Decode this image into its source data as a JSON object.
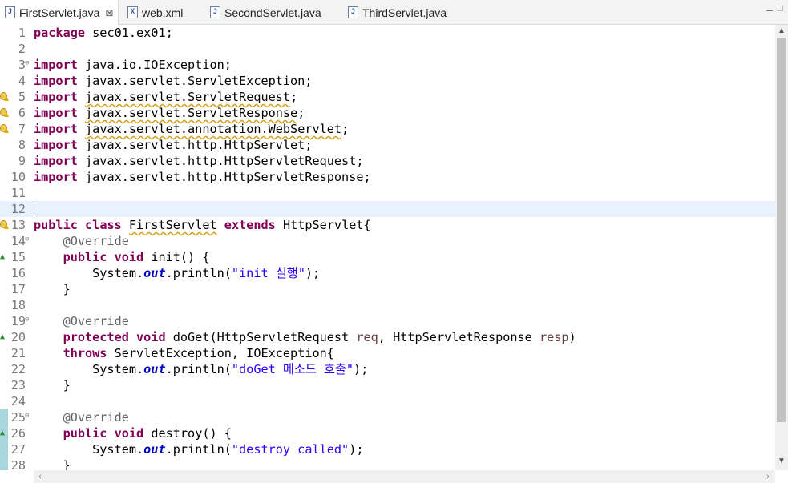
{
  "tabs": [
    {
      "label": "FirstServlet.java",
      "icon": "java-file-icon",
      "glyph": "J",
      "active": true,
      "close": "⊠"
    },
    {
      "label": "web.xml",
      "icon": "xml-file-icon",
      "glyph": "X"
    },
    {
      "label": "SecondServlet.java",
      "icon": "java-file-icon",
      "glyph": "J"
    },
    {
      "label": "ThirdServlet.java",
      "icon": "java-file-icon",
      "glyph": "J"
    }
  ],
  "window": {
    "minimize": "–",
    "maximize": "□"
  },
  "scroll": {
    "up": "▲",
    "down": "▼",
    "left": "‹",
    "right": "›"
  },
  "colors": {
    "keyword": "#7f0055",
    "annotation": "#646464",
    "string": "#2a00ff",
    "field": "#0000c0",
    "current_line": "#e8f2fe"
  },
  "editor": {
    "current_line": 12,
    "lines": [
      {
        "n": "1",
        "html": "<span class='kw'>package</span> sec01.ex01;"
      },
      {
        "n": "2",
        "html": ""
      },
      {
        "n": "3",
        "fold": true,
        "html": "<span class='kw'>import</span> java.io.IOException;"
      },
      {
        "n": "4",
        "html": "<span class='kw'>import</span> javax.servlet.ServletException;"
      },
      {
        "n": "5",
        "marker": "warning",
        "html": "<span class='kw'>import</span> <span class='warnline'>javax.servlet.ServletRequest</span>;"
      },
      {
        "n": "6",
        "marker": "warning",
        "html": "<span class='kw'>import</span> <span class='warnline'>javax.servlet.ServletResponse</span>;"
      },
      {
        "n": "7",
        "marker": "warning",
        "html": "<span class='kw'>import</span> <span class='warnline'>javax.servlet.annotation.WebServlet</span>;"
      },
      {
        "n": "8",
        "html": "<span class='kw'>import</span> javax.servlet.http.HttpServlet;"
      },
      {
        "n": "9",
        "html": "<span class='kw'>import</span> javax.servlet.http.HttpServletRequest;"
      },
      {
        "n": "10",
        "html": "<span class='kw'>import</span> javax.servlet.http.HttpServletResponse;"
      },
      {
        "n": "11",
        "html": ""
      },
      {
        "n": "12",
        "html": "<span class='caret'></span>"
      },
      {
        "n": "13",
        "marker": "warning",
        "html": "<span class='kw'>public</span> <span class='kw'>class</span> <span class='warnline'>FirstServlet</span> <span class='kw'>extends</span> HttpServlet{"
      },
      {
        "n": "14",
        "fold": true,
        "html": "    <span class='ann'>@Override</span>"
      },
      {
        "n": "15",
        "marker": "override",
        "html": "    <span class='kw'>public</span> <span class='kw'>void</span> init() {"
      },
      {
        "n": "16",
        "html": "        System.<span class='fld'>out</span>.println(<span class='str'>\"init 실행\"</span>);"
      },
      {
        "n": "17",
        "html": "    }"
      },
      {
        "n": "18",
        "html": ""
      },
      {
        "n": "19",
        "fold": true,
        "html": "    <span class='ann'>@Override</span>"
      },
      {
        "n": "20",
        "marker": "override",
        "html": "    <span class='kw'>protected</span> <span class='kw'>void</span> doGet(HttpServletRequest <span class='param'>req</span>, HttpServletResponse <span class='param'>resp</span>)"
      },
      {
        "n": "21",
        "html": "    <span class='kw'>throws</span> ServletException, IOException{"
      },
      {
        "n": "22",
        "html": "        System.<span class='fld'>out</span>.println(<span class='str'>\"doGet 메소드 호출\"</span>);"
      },
      {
        "n": "23",
        "html": "    }"
      },
      {
        "n": "24",
        "html": ""
      },
      {
        "n": "25",
        "fold": true,
        "html": "    <span class='ann'>@Override</span>"
      },
      {
        "n": "26",
        "marker": "override",
        "html": "    <span class='kw'>public</span> <span class='kw'>void</span> destroy() {"
      },
      {
        "n": "27",
        "html": "        System.<span class='fld'>out</span>.println(<span class='str'>\"destroy called\"</span>);"
      },
      {
        "n": "28",
        "html": "    }"
      }
    ]
  }
}
